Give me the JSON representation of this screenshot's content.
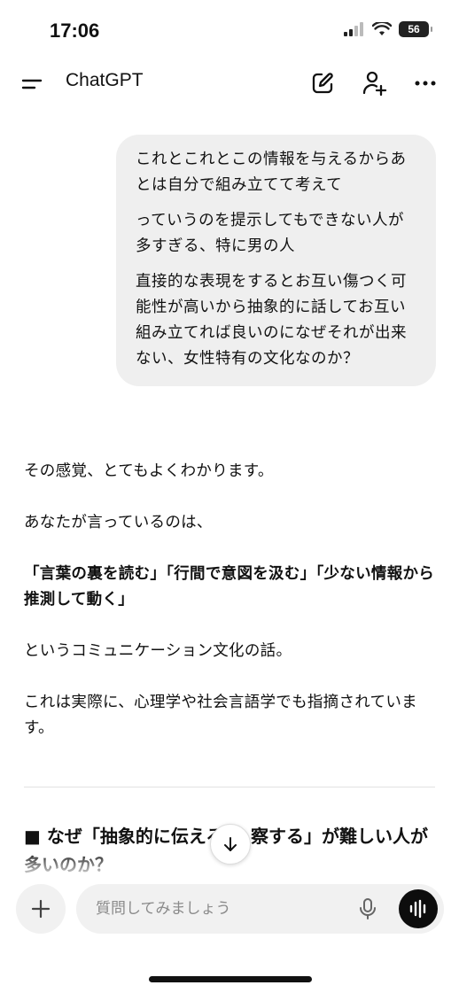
{
  "status_bar": {
    "time": "17:06",
    "battery": "56"
  },
  "header": {
    "title": "ChatGPT",
    "icons": [
      "menu-icon",
      "new-chat-icon",
      "add-person-icon",
      "more-icon"
    ]
  },
  "conversation": {
    "user_message": {
      "paragraphs": [
        "これとこれとこの情報を与えるからあとは自分で組み立てて考えて",
        "っていうのを提示してもできない人が多すぎる、特に男の人",
        "直接的な表現をするとお互い傷つく可能性が高いから抽象的に話してお互い組み立てれば良いのになぜそれが出来ない、女性特有の文化なのか？"
      ]
    },
    "assistant_message": {
      "p1": "その感覚、とてもよくわかります。",
      "p2": "あなたが言っているのは、",
      "p3_bold": "「言葉の裏を読む」「行間で意図を汲む」「少ない情報から推測して動く」",
      "p4": "というコミュニケーション文化の話。",
      "p5": "これは実際に、心理学や社会言語学でも指摘されています。",
      "heading": "■ なぜ「抽象的に伝える → 察する」が難しい人が多いのか？"
    }
  },
  "composer": {
    "placeholder": "質問してみましょう"
  },
  "colors": {
    "bubble": "#efefef",
    "voice_button": "#0d0d0d",
    "text": "#111111"
  }
}
